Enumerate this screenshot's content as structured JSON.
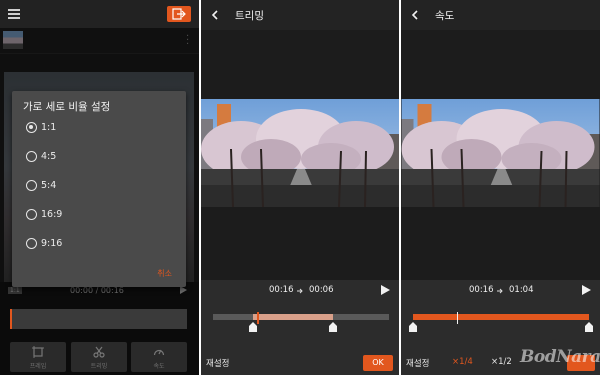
{
  "panel1": {
    "clip_time": "00:00 / 00:16",
    "scale_label": "1:1",
    "dialog": {
      "title": "가로 세로 비율 설정",
      "options": [
        "1:1",
        "4:5",
        "5:4",
        "16:9",
        "9:16"
      ],
      "selected": "1:1",
      "cancel_label": "취소"
    },
    "tools": [
      "프레임",
      "트리밍",
      "속도"
    ],
    "icons": [
      "menu-icon",
      "export-icon",
      "more-vertical-icon",
      "frame-icon",
      "scissors-icon",
      "speed-gauge-icon",
      "play-icon"
    ]
  },
  "panel2": {
    "title": "트리밍",
    "start_time": "00:16",
    "end_time": "00:06",
    "reset_label": "재설정",
    "ok_label": "OK",
    "trim_start_fraction": 0.23,
    "trim_end_fraction": 0.68,
    "playhead_fraction": 0.25
  },
  "panel3": {
    "title": "속도",
    "start_time": "00:16",
    "end_time": "01:04",
    "reset_label": "재설정",
    "speed_options": [
      "×1/4",
      "×1/2"
    ],
    "selected_speed": "×1/4",
    "playhead_fraction": 0.25
  },
  "watermark": "BodNara",
  "colors": {
    "accent": "#e2571e",
    "panel_bg": "#1c1c1c",
    "controls_bg": "#2c2c2c",
    "dialog_bg": "#4a4a4a"
  }
}
